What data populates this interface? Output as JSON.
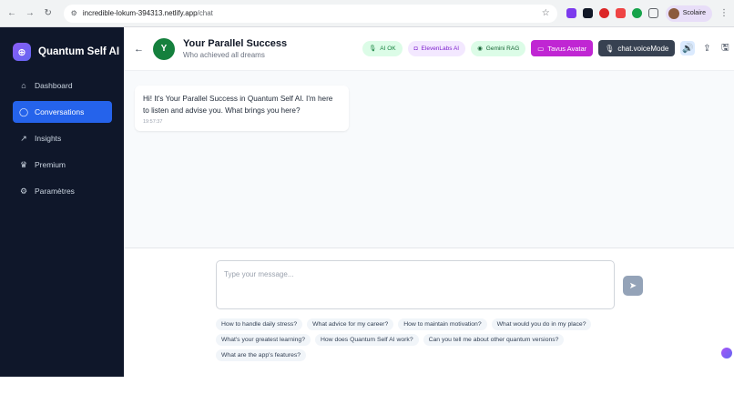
{
  "browser": {
    "url_host": "incredible-lokum-394313.netlify.app",
    "url_path": "/chat",
    "profile_name": "Scolaire"
  },
  "sidebar": {
    "app_name": "Quantum Self AI",
    "items": [
      {
        "label": "Dashboard",
        "icon": "home-icon"
      },
      {
        "label": "Conversations",
        "icon": "chat-icon"
      },
      {
        "label": "Insights",
        "icon": "trend-icon"
      },
      {
        "label": "Premium",
        "icon": "crown-icon"
      },
      {
        "label": "Paramètres",
        "icon": "gear-icon"
      }
    ],
    "active_index": 1
  },
  "header": {
    "avatar_letter": "Y",
    "title": "Your Parallel Success",
    "subtitle": "Who achieved all dreams",
    "badges": [
      "AI OK",
      "ElevenLabs AI",
      "Gemini RAG"
    ],
    "tavus_label": "Tavus Avatar",
    "voice_label": "chat.voiceMode"
  },
  "chat": {
    "messages": [
      {
        "text": "Hi! It's Your Parallel Success in Quantum Self AI. I'm here to listen and advise you. What brings you here?",
        "time": "19:57:37"
      }
    ]
  },
  "composer": {
    "placeholder": "Type your message...",
    "suggestions": [
      "How to handle daily stress?",
      "What advice for my career?",
      "How to maintain motivation?",
      "What would you do in my place?",
      "What's your greatest learning?",
      "How does Quantum Self AI work?",
      "Can you tell me about other quantum versions?",
      "What are the app's features?"
    ]
  },
  "colors": {
    "sidebar_bg": "#0f172a",
    "active_nav": "#2563eb",
    "tavus_button": "#c026d3",
    "voice_button": "#374151",
    "avatar": "#15803d"
  }
}
